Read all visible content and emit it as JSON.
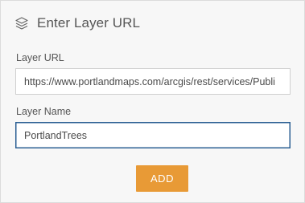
{
  "header": {
    "title": "Enter Layer URL",
    "icon": "layers-icon"
  },
  "form": {
    "url_label": "Layer URL",
    "url_value": "https://www.portlandmaps.com/arcgis/rest/services/Publi",
    "name_label": "Layer Name",
    "name_value": "PortlandTrees"
  },
  "actions": {
    "add_label": "ADD"
  },
  "colors": {
    "accent": "#e89a36",
    "focus_border": "#2b5f93",
    "panel_bg": "#f7f7f7"
  }
}
